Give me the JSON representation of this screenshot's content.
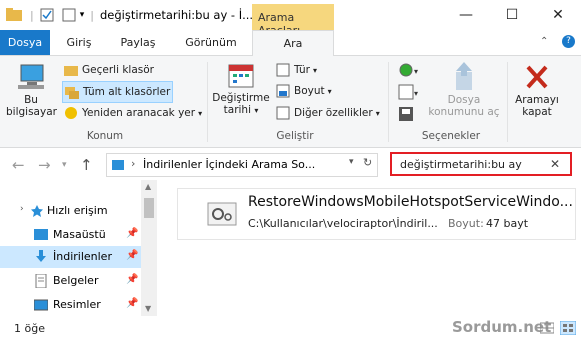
{
  "window": {
    "title": "değiştirmetarihi:bu ay - İ...",
    "context_tab": "Arama Araçları"
  },
  "tabs": [
    "Dosya",
    "Giriş",
    "Paylaş",
    "Görünüm",
    "Ara"
  ],
  "ribbon": {
    "location_group": {
      "this_pc_label": "Bu bilgisayar",
      "current_folder": "Geçerli klasör",
      "all_subfolders": "Tüm alt klasörler",
      "search_again": "Yeniden aranacak yer",
      "group_label": "Konum"
    },
    "refine_group": {
      "date_modified": "Değiştirme tarihi",
      "kind": "Tür",
      "size": "Boyut",
      "other_props": "Diğer özellikler",
      "group_label": "Geliştir"
    },
    "options_group": {
      "open_location": "Dosya konumunu aç",
      "group_label": "Seçenekler"
    },
    "close_search": "Aramayı kapat"
  },
  "address_bar": {
    "path": "İndirilenler İçindeki Arama So...",
    "search_text": "değiştirmetarihi:bu ay"
  },
  "nav_pane": {
    "items": [
      {
        "label": "Hızlı erişim",
        "icon": "star-icon"
      },
      {
        "label": "Masaüstü",
        "icon": "desktop-icon"
      },
      {
        "label": "İndirilenler",
        "icon": "download-icon"
      },
      {
        "label": "Belgeler",
        "icon": "documents-icon"
      },
      {
        "label": "Resimler",
        "icon": "pictures-icon"
      }
    ]
  },
  "result": {
    "name": "RestoreWindowsMobileHotspotServiceWindo...",
    "path": "C:\\Kullanıcılar\\velociraptor\\İndiril...",
    "size_label": "Boyut:",
    "size_value": "47 bayt"
  },
  "status": {
    "count": "1 öğe",
    "watermark": "Sordum.net"
  },
  "colors": {
    "accent": "#1979ca",
    "context_tab": "#f6d77e",
    "highlight": "#e31e24",
    "selection": "#cce8ff"
  }
}
